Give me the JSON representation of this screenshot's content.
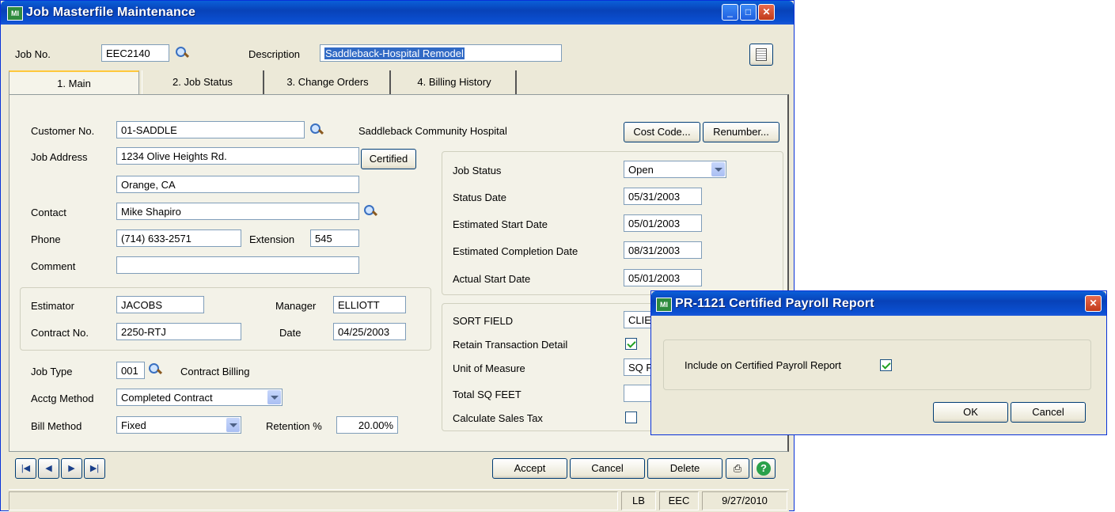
{
  "main_window": {
    "title": "Job Masterfile Maintenance",
    "app_icon_text": "MI"
  },
  "header": {
    "job_no_label": "Job No.",
    "job_no_value": "EEC2140",
    "description_label": "Description",
    "description_value": "Saddleback-Hospital Remodel"
  },
  "tabs": [
    {
      "label": "1. Main"
    },
    {
      "label": "2. Job Status"
    },
    {
      "label": "3. Change Orders"
    },
    {
      "label": "4. Billing History"
    }
  ],
  "main": {
    "customer_no_label": "Customer No.",
    "customer_no_value": "01-SADDLE",
    "customer_name": "Saddleback Community Hospital",
    "cost_code_button": "Cost Code...",
    "renumber_button": "Renumber...",
    "job_address_label": "Job Address",
    "address_line1": "1234 Olive Heights Rd.",
    "address_line2": "Orange, CA",
    "certified_button": "Certified",
    "contact_label": "Contact",
    "contact_value": "Mike Shapiro",
    "phone_label": "Phone",
    "phone_value": "(714) 633-2571",
    "extension_label": "Extension",
    "extension_value": "545",
    "comment_label": "Comment",
    "comment_value": "",
    "estimator_label": "Estimator",
    "estimator_value": "JACOBS",
    "manager_label": "Manager",
    "manager_value": "ELLIOTT",
    "contract_no_label": "Contract No.",
    "contract_no_value": "2250-RTJ",
    "date_label": "Date",
    "date_value": "04/25/2003",
    "job_type_label": "Job Type",
    "job_type_value": "001",
    "job_type_desc": "Contract Billing",
    "acctg_method_label": "Acctg Method",
    "acctg_method_value": "Completed Contract",
    "bill_method_label": "Bill Method",
    "bill_method_value": "Fixed",
    "retention_label": "Retention %",
    "retention_value": "20.00%"
  },
  "status_group": {
    "job_status_label": "Job Status",
    "job_status_value": "Open",
    "status_date_label": "Status Date",
    "status_date_value": "05/31/2003",
    "est_start_label": "Estimated Start Date",
    "est_start_value": "05/01/2003",
    "est_completion_label": "Estimated Completion Date",
    "est_completion_value": "08/31/2003",
    "actual_start_label": "Actual Start Date",
    "actual_start_value": "05/01/2003"
  },
  "misc_group": {
    "sort_field_label": "SORT FIELD",
    "sort_field_value": "CLIE",
    "retain_detail_label": "Retain Transaction Detail",
    "retain_detail_checked": true,
    "uom_label": "Unit of Measure",
    "uom_value": "SQ F",
    "total_sq_feet_label": "Total SQ FEET",
    "total_sq_feet_value": "",
    "calc_sales_tax_label": "Calculate Sales Tax",
    "calc_sales_tax_checked": false
  },
  "footer": {
    "accept_button": "Accept",
    "cancel_button": "Cancel",
    "delete_button": "Delete"
  },
  "statusbar": {
    "user": "LB",
    "company": "EEC",
    "date": "9/27/2010"
  },
  "dialog": {
    "title": "PR-1121 Certified Payroll Report",
    "include_label": "Include on Certified Payroll Report",
    "include_checked": true,
    "ok_button": "OK",
    "cancel_button": "Cancel"
  },
  "colors": {
    "titlebar": "#0a4fd0",
    "window_bg": "#ece9d8",
    "panel_bg": "#f3f2e8",
    "selection": "#316ac5"
  }
}
